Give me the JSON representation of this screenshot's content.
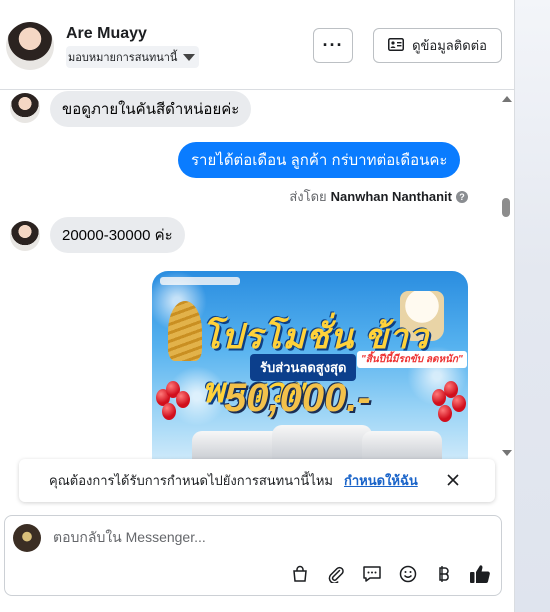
{
  "header": {
    "contact_name": "Are Muayy",
    "assign_label": "มอบหมายการสนทนานี้",
    "more_label": "···",
    "contact_button_label": "ดูข้อมูลติดต่อ"
  },
  "messages": [
    {
      "direction": "in",
      "text": "ขอดูภายในคันสีดำหน่อยค่ะ"
    },
    {
      "direction": "out",
      "text": "รายได้ต่อเดือน ลูกค้า กร่บาทต่อเดือนคะ"
    },
    {
      "direction": "in",
      "text": "20000-30000 ค่ะ"
    }
  ],
  "sent_by": {
    "prefix": "ส่งโดย",
    "name": "Nanwhan Nanthanit"
  },
  "promo_image": {
    "title": "โปรโมชั่น ข้าวพารวย",
    "subtitle": "\"สิ้นปีนี้มีรถขับ ลดหนัก\"",
    "badge": "รับส่วนลดสูงสุด",
    "amount": "50,000.-"
  },
  "notice": {
    "text": "คุณต้องการได้รับการกำหนดไปยังการสนทนานี้ไหม",
    "link_label": "กำหนดให้ฉัน"
  },
  "composer": {
    "placeholder": "ตอบกลับใน Messenger..."
  },
  "toolbar_icons": [
    "bag-icon",
    "paperclip-icon",
    "chat-bubble-icon",
    "emoji-icon",
    "baht-icon",
    "thumbs-up-icon"
  ]
}
